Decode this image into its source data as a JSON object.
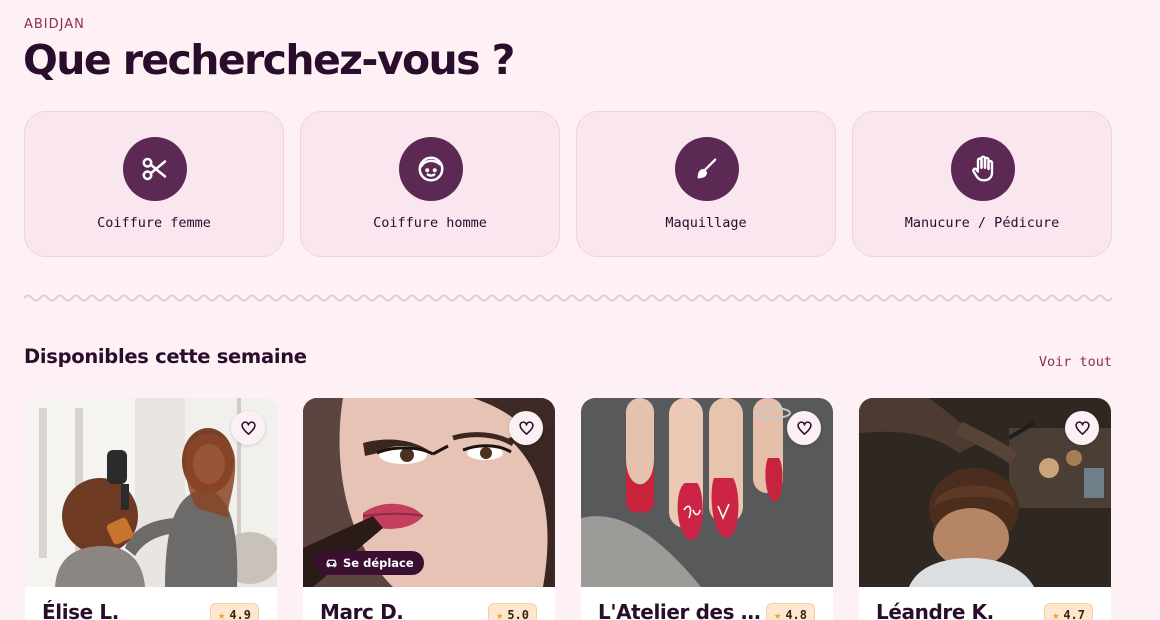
{
  "header": {
    "city": "ABIDJAN",
    "title": "Que recherchez-vous ?"
  },
  "categories": [
    {
      "label": "Coiffure femme",
      "icon": "scissors-icon"
    },
    {
      "label": "Coiffure homme",
      "icon": "face-icon"
    },
    {
      "label": "Maquillage",
      "icon": "brush-icon"
    },
    {
      "label": "Manucure / Pédicure",
      "icon": "hand-icon"
    }
  ],
  "available": {
    "title": "Disponibles cette semaine",
    "see_all": "Voir tout"
  },
  "cards": [
    {
      "name": "Élise L.",
      "rating": "4.9",
      "badge": ""
    },
    {
      "name": "Marc D.",
      "rating": "5.0",
      "badge": "Se déplace"
    },
    {
      "name": "L'Atelier des …",
      "rating": "4.8",
      "badge": ""
    },
    {
      "name": "Léandre K.",
      "rating": "4.7",
      "badge": ""
    }
  ],
  "colors": {
    "background": "#fdf1f5",
    "accent": "#5b2954",
    "category_bg": "#f9e6ee",
    "title": "#2a0c2b",
    "link": "#8e2f4f"
  }
}
